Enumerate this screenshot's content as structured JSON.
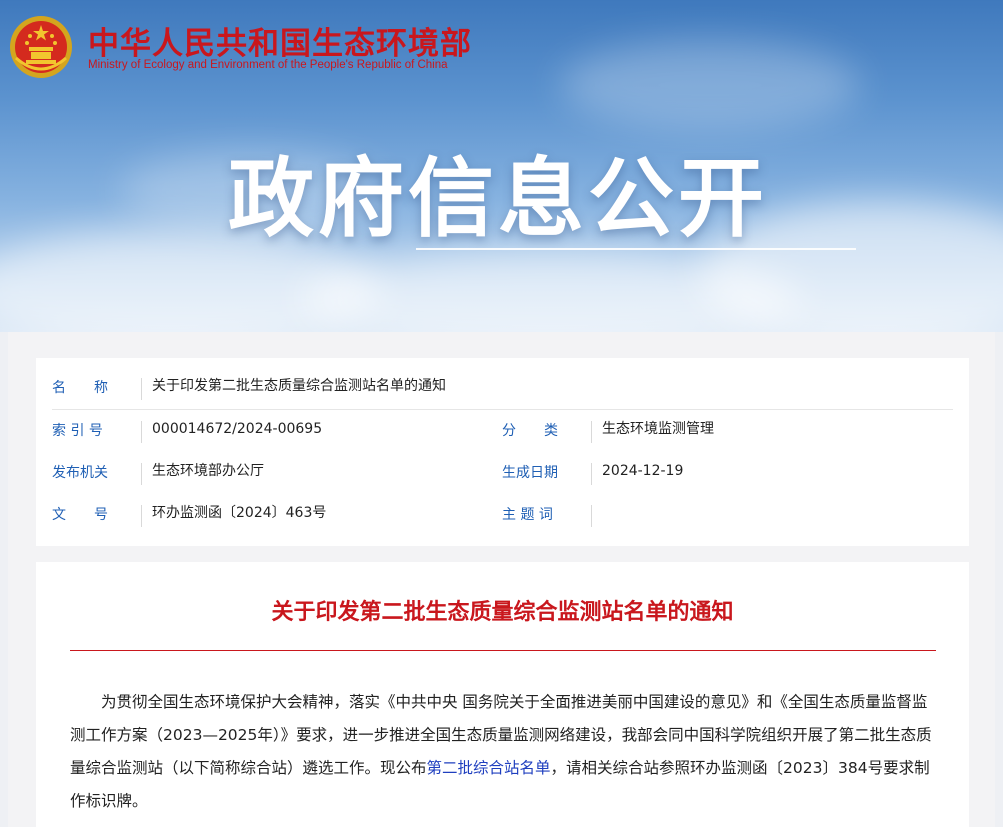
{
  "header": {
    "site_name_cn": "中华人民共和国生态环境部",
    "site_name_en": "Ministry of Ecology and Environment of the People's Republic of China",
    "banner_title": "政府信息公开",
    "emblem_icon": "national-emblem-icon"
  },
  "info": {
    "name_label": "名　　称",
    "name_value": "关于印发第二批生态质量综合监测站名单的通知",
    "index_label": "索 引 号",
    "index_value": "000014672/2024-00695",
    "category_label": "分　　类",
    "category_value": "生态环境监测管理",
    "issuer_label": "发布机关",
    "issuer_value": "生态环境部办公厅",
    "date_label": "生成日期",
    "date_value": "2024-12-19",
    "docno_label": "文　　号",
    "docno_value": "环办监测函〔2024〕463号",
    "keywords_label": "主 题 词",
    "keywords_value": ""
  },
  "document": {
    "title": "关于印发第二批生态质量综合监测站名单的通知",
    "para_part1": "为贯彻全国生态环境保护大会精神，落实《中共中央 国务院关于全面推进美丽中国建设的意见》和《全国生态质量监督监测工作方案（2023—2025年）》要求，进一步推进全国生态质量监测网络建设，我部会同中国科学院组织开展了第二批生态质量综合监测站（以下简称综合站）遴选工作。现公布",
    "para_link": "第二批综合站名单",
    "para_part2": "，请相关综合站参照环办监测函〔2023〕384号要求制作标识牌。"
  },
  "colors": {
    "brand_red": "#c9171d",
    "label_blue": "#1f5fb4",
    "link_blue": "#1f3fbf"
  }
}
